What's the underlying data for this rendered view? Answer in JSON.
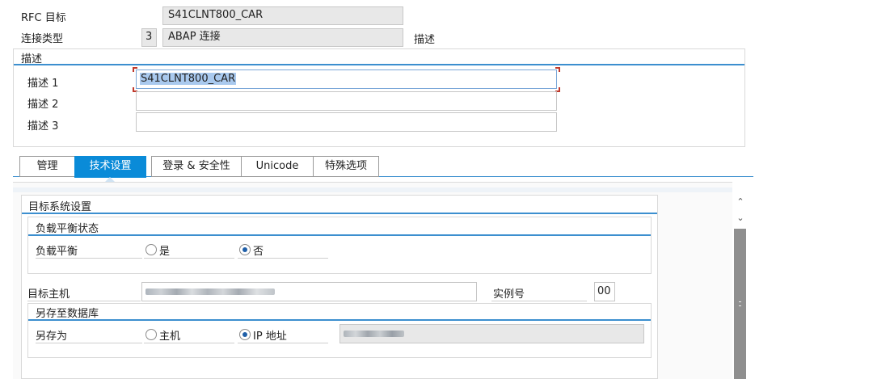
{
  "header": {
    "rfc_target_label": "RFC 目标",
    "rfc_target_value": "S41CLNT800_CAR",
    "conn_type_label": "连接类型",
    "conn_type_code": "3",
    "conn_type_value": "ABAP 连接",
    "desc_side_label": "描述"
  },
  "description": {
    "title": "描述",
    "desc1_label": "描述 1",
    "desc1_value": "S41CLNT800_CAR",
    "desc2_label": "描述 2",
    "desc2_value": "",
    "desc3_label": "描述 3",
    "desc3_value": ""
  },
  "tabs": [
    {
      "label": "管理"
    },
    {
      "label": "技术设置"
    },
    {
      "label": "登录 & 安全性"
    },
    {
      "label": "Unicode"
    },
    {
      "label": "特殊选项"
    }
  ],
  "active_tab": "技术设置",
  "target_system": {
    "title": "目标系统设置",
    "load_balance_group": "负载平衡状态",
    "load_balance_label": "负载平衡",
    "opt_yes": "是",
    "opt_no": "否",
    "load_balance_selected": "否",
    "target_host_label": "目标主机",
    "instance_label": "实例号",
    "instance_value": "00",
    "save_db_group": "另存至数据库",
    "save_as_label": "另存为",
    "opt_host": "主机",
    "opt_ip": "IP 地址",
    "save_as_selected": "IP 地址"
  },
  "colors": {
    "accent": "#0a8bd8",
    "rule": "#3c8fcf",
    "selection": "#a9c9ee"
  }
}
